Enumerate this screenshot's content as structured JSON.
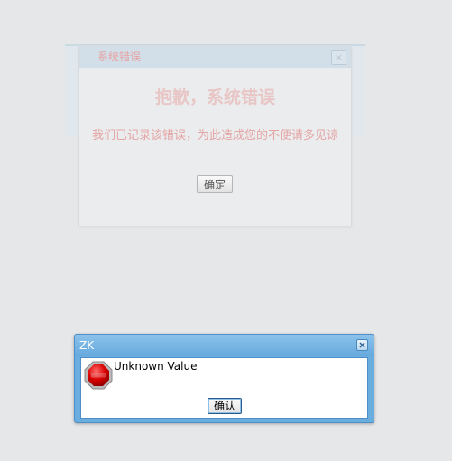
{
  "background_dialog": {
    "title": "系统错误",
    "heading": "抱歉，系统错误",
    "message": "我们已记录该错误，为此造成您的不便请多见谅",
    "ok_label": "确定"
  },
  "messagebox": {
    "title": "ZK",
    "icon": "stop-error-icon",
    "message": "Unknown Value",
    "ok_label": "确认"
  },
  "colors": {
    "page_background": "#e6e7e9",
    "window_frame": "#6aaee0",
    "error_icon_red": "#d90000",
    "faded_error_text": "#e4a5a5"
  }
}
